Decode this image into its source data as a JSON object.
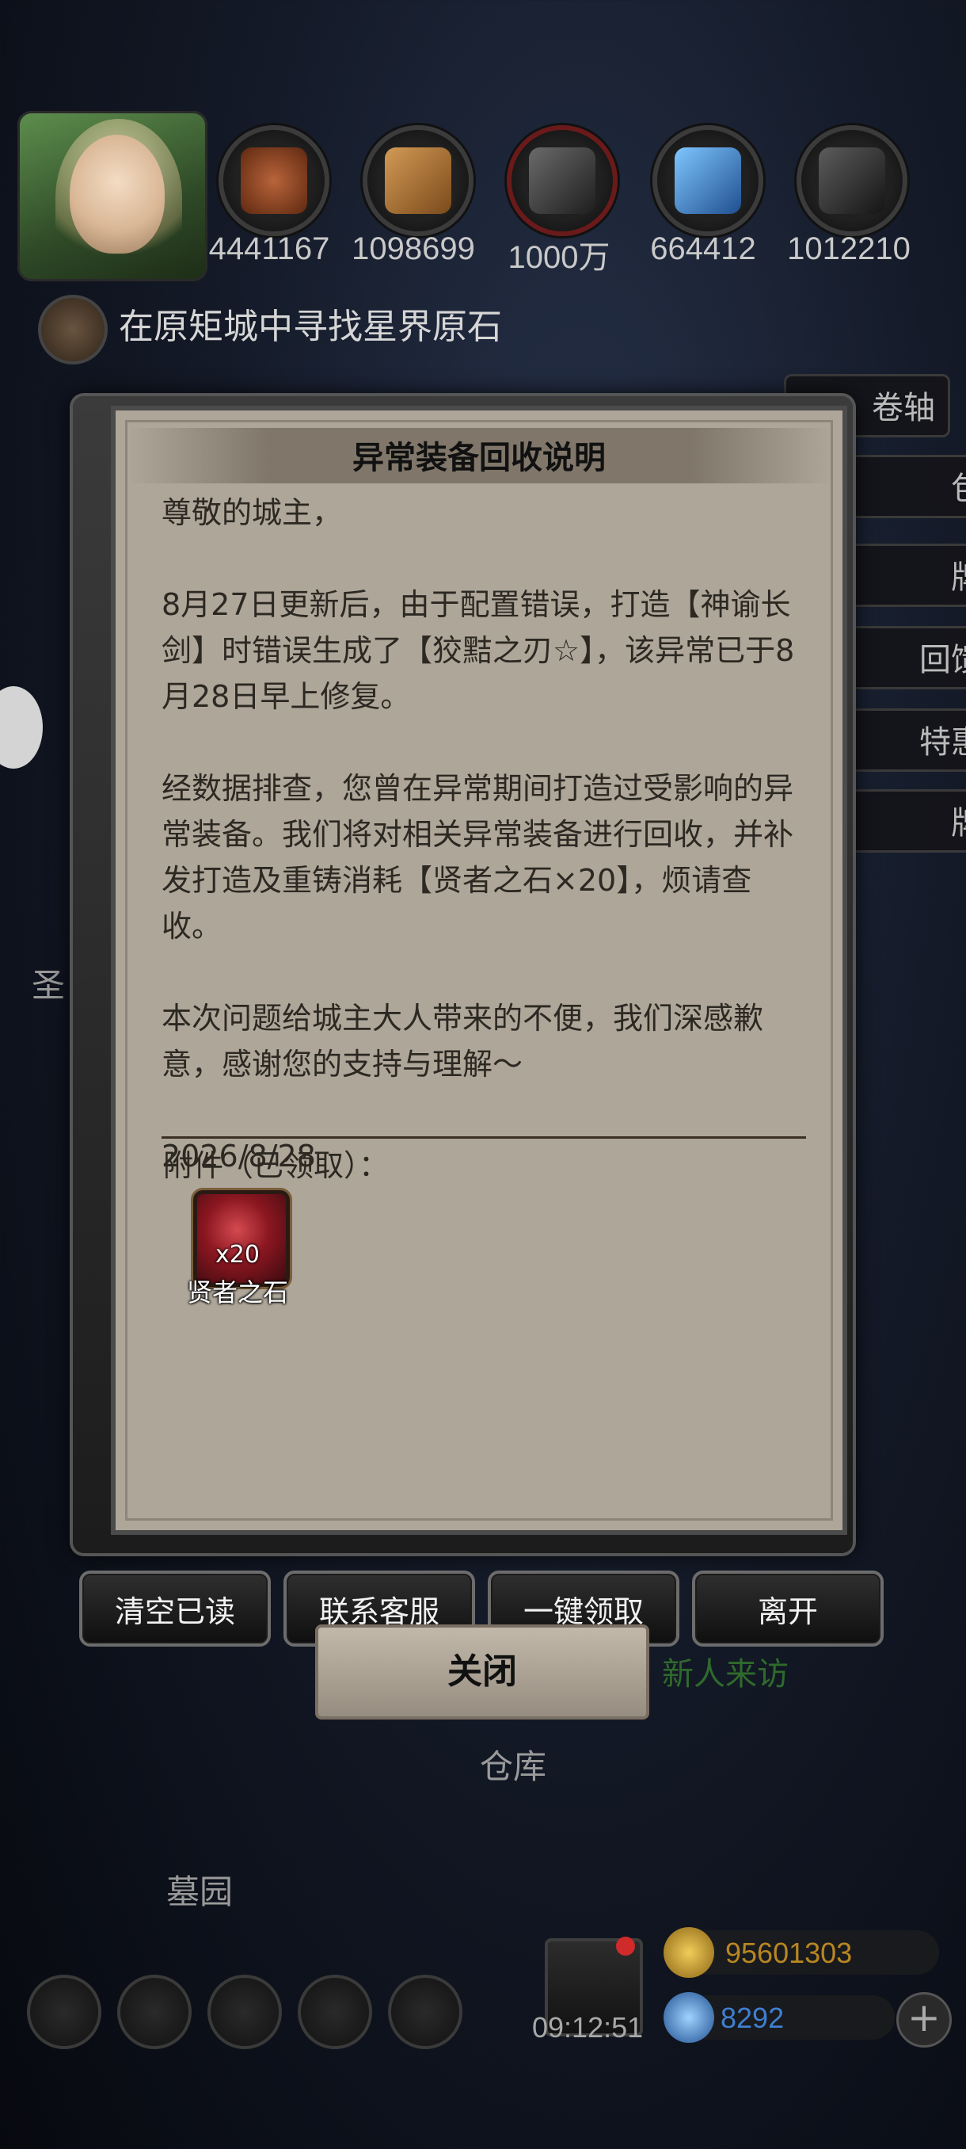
{
  "resources": [
    {
      "icon": "meat-icon",
      "value": "4441167",
      "color": "#7a3a1f"
    },
    {
      "icon": "wood-icon",
      "value": "1098699",
      "color": "#a0632a"
    },
    {
      "icon": "stone-icon",
      "value": "1000万",
      "color": "#444444"
    },
    {
      "icon": "crystal-icon",
      "value": "664412",
      "color": "#3a7fc2"
    },
    {
      "icon": "iron-icon",
      "value": "1012210",
      "color": "#3a3a3a"
    }
  ],
  "quest": {
    "text": "在原矩城中寻找星界原石"
  },
  "side_buttons": [
    "卷轴",
    "包",
    "牌",
    "回馈",
    "特惠",
    "牌"
  ],
  "background": {
    "left_partial_label": "圣",
    "warehouse_label": "仓库",
    "graveyard_label": "墓园",
    "new_visitor_label": "新人来访"
  },
  "mail": {
    "title": "异常装备回收说明",
    "body": "尊敬的城主，\n\n8月27日更新后，由于配置错误，打造【神谕长剑】时错误生成了【狡黠之刃☆】，该异常已于8月28日早上修复。\n\n经数据排查，您曾在异常期间打造过受影响的异常装备。我们将对相关异常装备进行回收，并补发打造及重铸消耗【贤者之石×20】，烦请查收。\n\n本次问题给城主大人带来的不便，我们深感歉意，感谢您的支持与理解～\n\n2026/8/28",
    "attachment_label": "附件（已领取）：",
    "attachment": {
      "icon": "sage-stone-icon",
      "count": "x20",
      "name": "贤者之石"
    }
  },
  "buttons": {
    "clear_read": "清空已读",
    "contact_support": "联系客服",
    "claim_all": "一键领取",
    "leave": "离开",
    "close": "关闭"
  },
  "bottom": {
    "timer": "09:12:51",
    "gold": "95601303",
    "gems": "8292",
    "colors": {
      "gold": "#c99a2a",
      "gem": "#3f7fd0"
    }
  }
}
